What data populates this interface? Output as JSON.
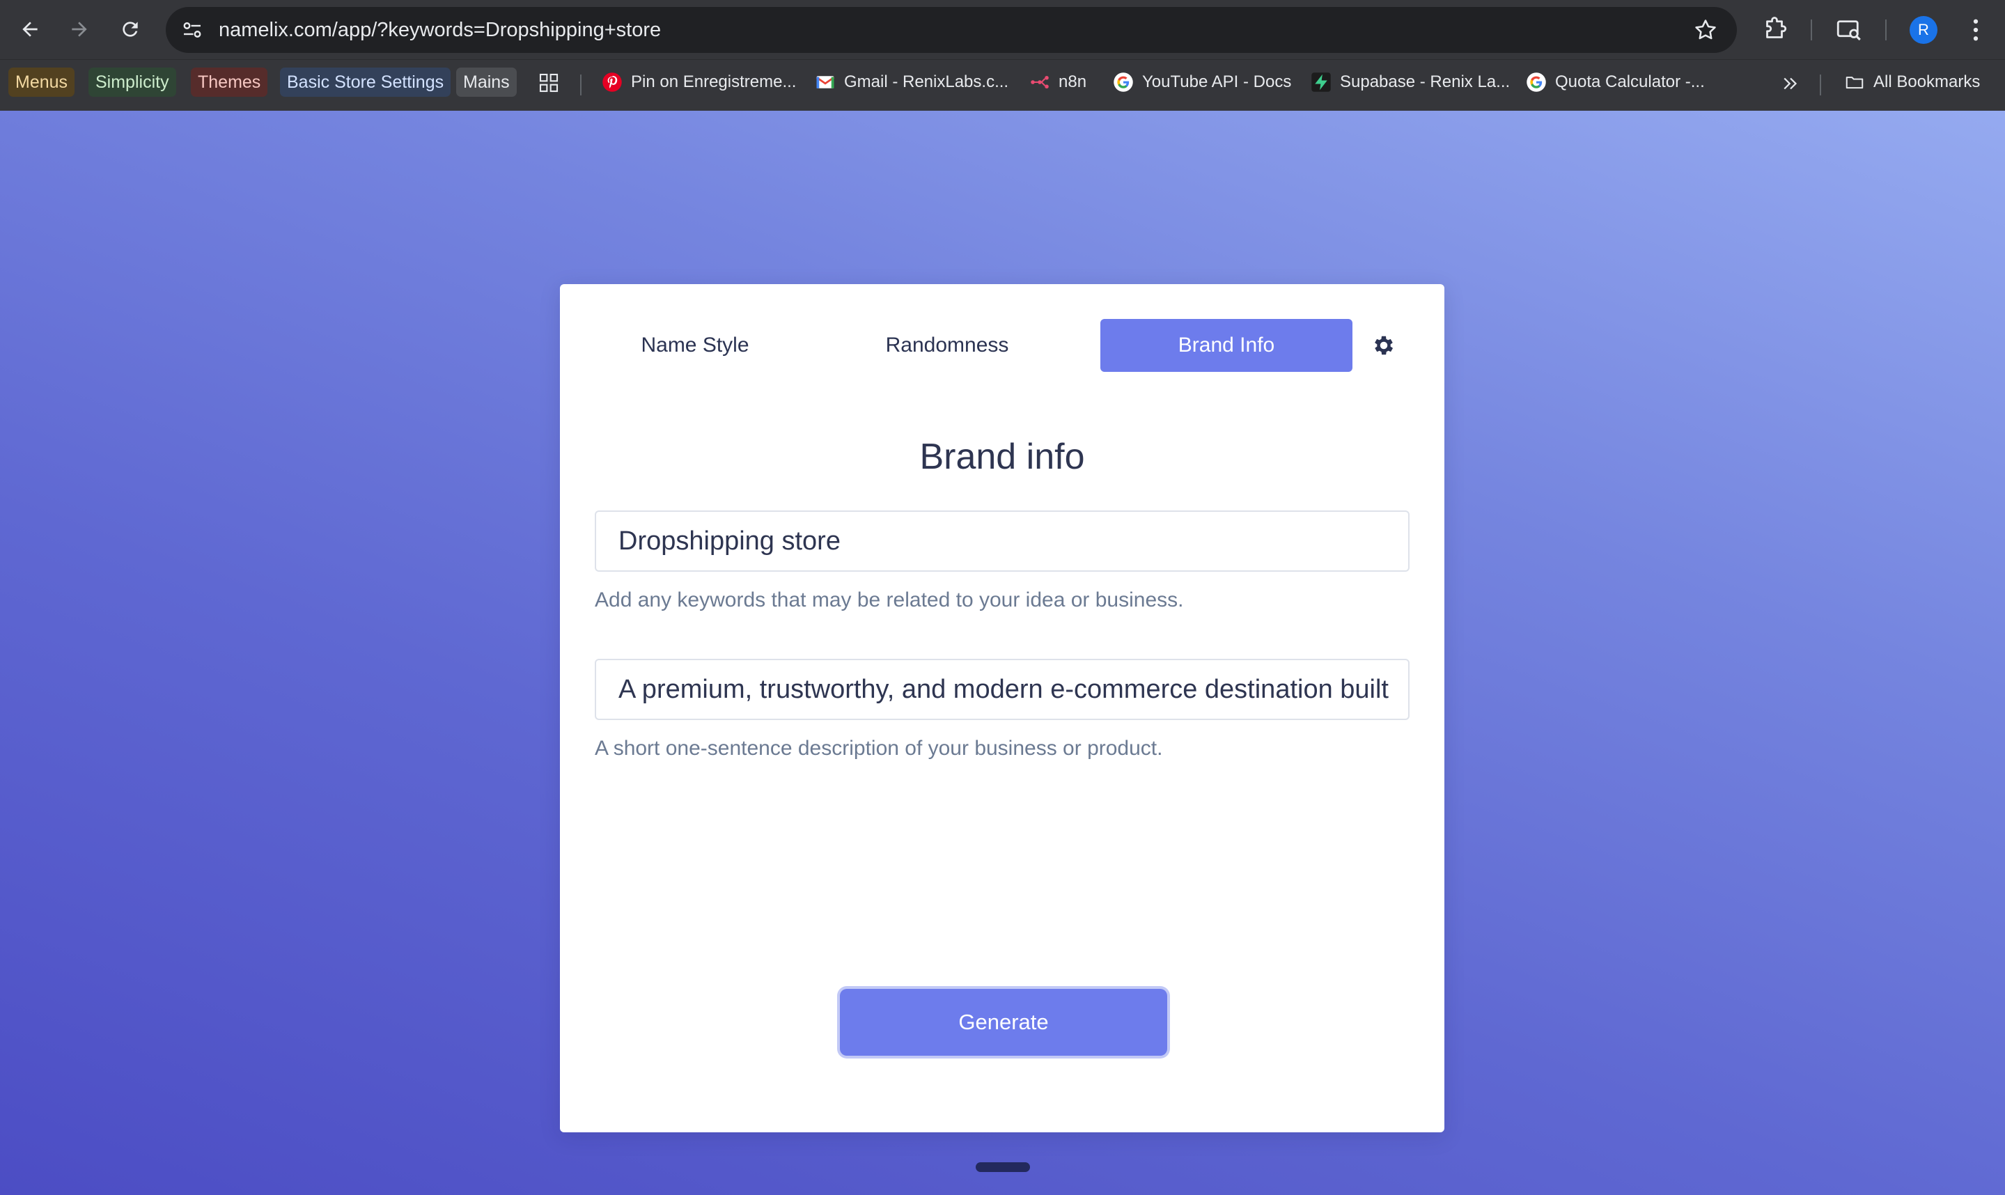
{
  "browser": {
    "url": "namelix.com/app/?keywords=Dropshipping+store",
    "avatar_letter": "R",
    "bookmarks_chips": [
      {
        "label": "Menus",
        "bg": "#524120",
        "fg": "#f3d9a2"
      },
      {
        "label": "Simplicity",
        "bg": "#2f4535",
        "fg": "#cdeccc"
      },
      {
        "label": "Themes",
        "bg": "#562c2b",
        "fg": "#f6c7c2"
      },
      {
        "label": "Basic Store Settings",
        "bg": "#33415a",
        "fg": "#d3e2ff"
      },
      {
        "label": "Mains",
        "bg": "#4b4d51",
        "fg": "#e8eaed"
      }
    ],
    "bookmarks_links": [
      {
        "label": "Pin on Enregistreme...",
        "icon": "pinterest-icon"
      },
      {
        "label": "Gmail - RenixLabs.c...",
        "icon": "gmail-icon"
      },
      {
        "label": "n8n",
        "icon": "n8n-icon"
      },
      {
        "label": "YouTube API - Docs",
        "icon": "google-icon"
      },
      {
        "label": "Supabase - Renix La...",
        "icon": "supabase-icon"
      },
      {
        "label": "Quota Calculator -...",
        "icon": "google-icon"
      }
    ],
    "all_bookmarks": "All Bookmarks"
  },
  "app": {
    "tabs": [
      {
        "label": "Name Style",
        "active": false
      },
      {
        "label": "Randomness",
        "active": false
      },
      {
        "label": "Brand Info",
        "active": true
      }
    ],
    "title": "Brand info",
    "keywords_value": "Dropshipping store",
    "keywords_helper": "Add any keywords that may be related to your idea or business.",
    "description_value": "A premium, trustworthy, and modern e-commerce destination built",
    "description_helper": "A short one-sentence description of your business or product.",
    "generate_label": "Generate"
  },
  "colors": {
    "accent": "#6d7cec",
    "text_dark": "#2e3551",
    "helper": "#6b7a92"
  }
}
